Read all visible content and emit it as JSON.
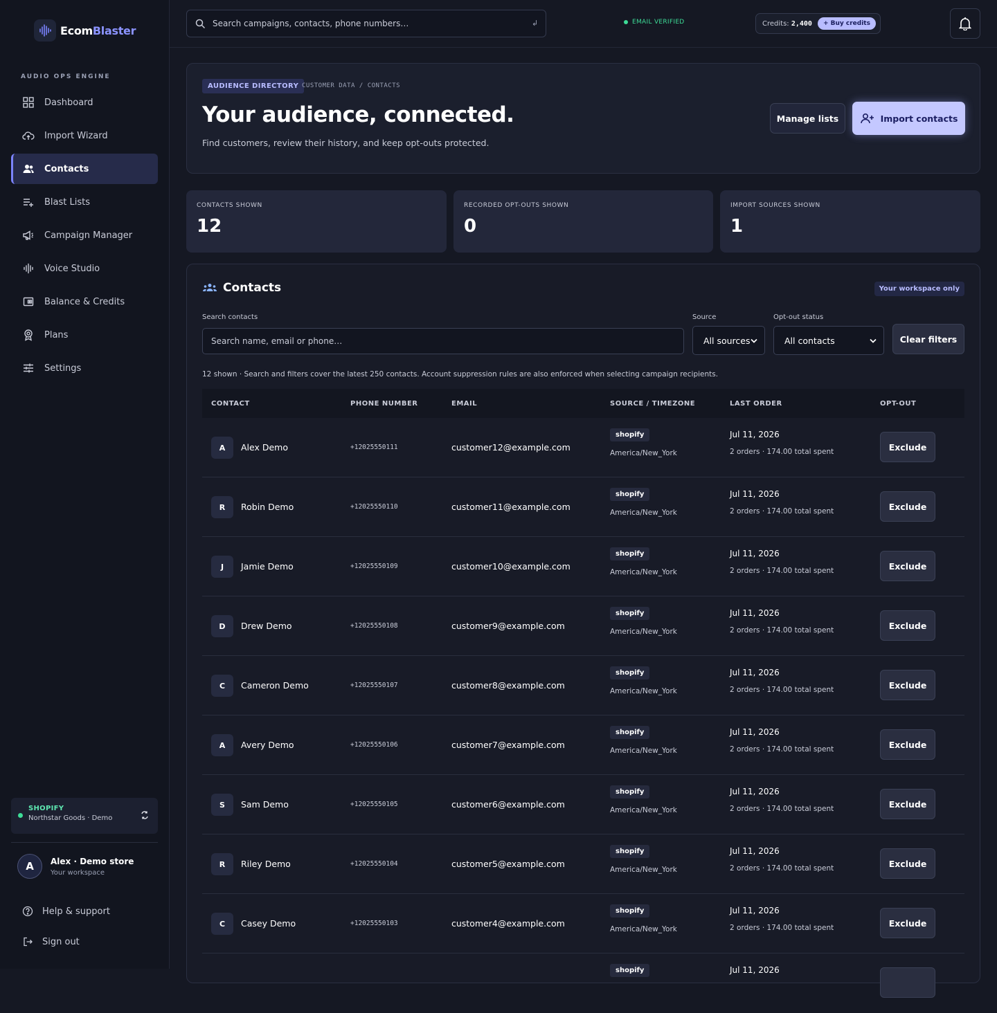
{
  "brand": {
    "name_part1": "Ecom",
    "name_part2": "Blaster",
    "accent": "#8b93ff"
  },
  "sidebar": {
    "section_label": "AUDIO OPS ENGINE",
    "items": [
      {
        "label": "Dashboard",
        "icon": "dashboard-icon"
      },
      {
        "label": "Import Wizard",
        "icon": "cloud-upload-icon"
      },
      {
        "label": "Contacts",
        "icon": "users-icon",
        "active": true
      },
      {
        "label": "Blast Lists",
        "icon": "list-add-icon"
      },
      {
        "label": "Campaign Manager",
        "icon": "megaphone-icon"
      },
      {
        "label": "Voice Studio",
        "icon": "waveform-icon"
      },
      {
        "label": "Balance & Credits",
        "icon": "wallet-icon"
      },
      {
        "label": "Plans",
        "icon": "badge-icon"
      },
      {
        "label": "Settings",
        "icon": "sliders-icon"
      }
    ],
    "store": {
      "platform": "SHOPIFY",
      "name": "Northstar Goods · Demo"
    },
    "user": {
      "initial": "A",
      "name": "Alex · Demo store",
      "sub": "Your workspace"
    },
    "help": "Help & support",
    "signout": "Sign out"
  },
  "topbar": {
    "search_placeholder": "Search campaigns, contacts, phone numbers…",
    "verified": "EMAIL VERIFIED",
    "credits_label": "Credits:",
    "credits_value": "2,400",
    "buy_label": "+ Buy credits"
  },
  "hero": {
    "pill": "AUDIENCE DIRECTORY",
    "crumb": "CUSTOMER DATA / CONTACTS",
    "title": "Your audience, connected.",
    "subtitle": "Find customers, review their history, and keep opt-outs protected.",
    "manage_label": "Manage lists",
    "import_label": "Import contacts"
  },
  "stats": [
    {
      "label": "CONTACTS SHOWN",
      "value": "12"
    },
    {
      "label": "RECORDED OPT-OUTS SHOWN",
      "value": "0"
    },
    {
      "label": "IMPORT SOURCES SHOWN",
      "value": "1"
    }
  ],
  "contacts": {
    "title": "Contacts",
    "workspace_pill": "Your workspace only",
    "search_label": "Search contacts",
    "search_placeholder": "Search name, email or phone…",
    "source_label": "Source",
    "source_value": "All sources",
    "optout_label": "Opt-out status",
    "optout_value": "All contacts",
    "clear_label": "Clear filters",
    "note": "12 shown · Search and filters cover the latest 250 contacts. Account suppression rules are also enforced when selecting campaign recipients.",
    "columns": [
      "CONTACT",
      "PHONE NUMBER",
      "EMAIL",
      "SOURCE / TIMEZONE",
      "LAST ORDER",
      "OPT-OUT"
    ],
    "rows": [
      {
        "initial": "A",
        "name": "Alex Demo",
        "phone": "+12025550111",
        "email": "customer12@example.com",
        "source": "shopify",
        "tz": "America/New_York",
        "date": "Jul 11, 2026",
        "orders": "2 orders · 174.00 total spent",
        "action": "Exclude"
      },
      {
        "initial": "R",
        "name": "Robin Demo",
        "phone": "+12025550110",
        "email": "customer11@example.com",
        "source": "shopify",
        "tz": "America/New_York",
        "date": "Jul 11, 2026",
        "orders": "2 orders · 174.00 total spent",
        "action": "Exclude"
      },
      {
        "initial": "J",
        "name": "Jamie Demo",
        "phone": "+12025550109",
        "email": "customer10@example.com",
        "source": "shopify",
        "tz": "America/New_York",
        "date": "Jul 11, 2026",
        "orders": "2 orders · 174.00 total spent",
        "action": "Exclude"
      },
      {
        "initial": "D",
        "name": "Drew Demo",
        "phone": "+12025550108",
        "email": "customer9@example.com",
        "source": "shopify",
        "tz": "America/New_York",
        "date": "Jul 11, 2026",
        "orders": "2 orders · 174.00 total spent",
        "action": "Exclude"
      },
      {
        "initial": "C",
        "name": "Cameron Demo",
        "phone": "+12025550107",
        "email": "customer8@example.com",
        "source": "shopify",
        "tz": "America/New_York",
        "date": "Jul 11, 2026",
        "orders": "2 orders · 174.00 total spent",
        "action": "Exclude"
      },
      {
        "initial": "A",
        "name": "Avery Demo",
        "phone": "+12025550106",
        "email": "customer7@example.com",
        "source": "shopify",
        "tz": "America/New_York",
        "date": "Jul 11, 2026",
        "orders": "2 orders · 174.00 total spent",
        "action": "Exclude"
      },
      {
        "initial": "S",
        "name": "Sam Demo",
        "phone": "+12025550105",
        "email": "customer6@example.com",
        "source": "shopify",
        "tz": "America/New_York",
        "date": "Jul 11, 2026",
        "orders": "2 orders · 174.00 total spent",
        "action": "Exclude"
      },
      {
        "initial": "R",
        "name": "Riley Demo",
        "phone": "+12025550104",
        "email": "customer5@example.com",
        "source": "shopify",
        "tz": "America/New_York",
        "date": "Jul 11, 2026",
        "orders": "2 orders · 174.00 total spent",
        "action": "Exclude"
      },
      {
        "initial": "C",
        "name": "Casey Demo",
        "phone": "+12025550103",
        "email": "customer4@example.com",
        "source": "shopify",
        "tz": "America/New_York",
        "date": "Jul 11, 2026",
        "orders": "2 orders · 174.00 total spent",
        "action": "Exclude"
      },
      {
        "initial": "",
        "name": "",
        "phone": "",
        "email": "",
        "source": "shopify",
        "tz": "",
        "date": "Jul 11, 2026",
        "orders": "",
        "action": ""
      }
    ]
  }
}
